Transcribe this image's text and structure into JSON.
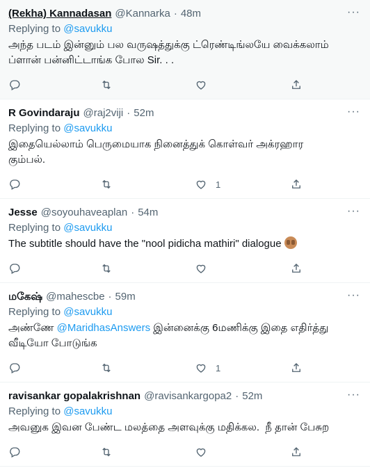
{
  "tweets": [
    {
      "name": "(Rekha) Kannadasan",
      "handle": "@Kannarka",
      "dot": "·",
      "time": "48m",
      "replying_prefix": "Replying to",
      "replying_to": "@savukku",
      "text": "அந்த படம் இன்னும் பல வருஷத்துக்கு ட்ரெண்டிங்லயே வைக்கலாம் ப்ளான் பன்னிட்டாங்க போல Sir. . .",
      "like_count": ""
    },
    {
      "name": "R Govindaraju",
      "handle": "@raj2viji",
      "dot": "·",
      "time": "52m",
      "replying_prefix": "Replying to",
      "replying_to": "@savukku",
      "text": "இதையெல்லாம் பெருமையாக நினைத்துக் கொள்வர் அக்ரஹார கும்பல்.",
      "like_count": "1"
    },
    {
      "name": "Jesse",
      "handle": "@soyouhaveaplan",
      "dot": "·",
      "time": "54m",
      "replying_prefix": "Replying to",
      "replying_to": "@savukku",
      "text": "The subtitle should have the \"nool pidicha mathiri\" dialogue ",
      "emoji": "see-no-evil-monkey-emoji",
      "like_count": ""
    },
    {
      "name": "மகேஷ்",
      "handle": "@mahescbe",
      "dot": "·",
      "time": "59m",
      "replying_prefix": "Replying to",
      "replying_to": "@savukku",
      "text_pre": "அண்ணே ",
      "text_mention": "@MaridhasAnswers",
      "text_post": " இன்னைக்கு 6மணிக்கு இதை எதிர்த்து வீடியோ போடுங்க",
      "like_count": "1"
    },
    {
      "name": "ravisankar gopalakrishnan",
      "handle": "@ravisankargopa2",
      "dot": "·",
      "time": "52m",
      "replying_prefix": "Replying to",
      "replying_to": "@savukku",
      "text": "அவனுக இவன பேண்ட மலத்தை அளவுக்கு மதிக்கல.  நீ தான் பேசுற",
      "like_count": ""
    }
  ],
  "more_glyph": "···",
  "colors": {
    "link": "#1d9bf0",
    "muted": "#536471",
    "text": "#0f1419",
    "hover_bg": "#f7f9f9"
  },
  "icons": [
    "reply-icon",
    "retweet-icon",
    "like-icon",
    "share-icon",
    "more-icon"
  ]
}
